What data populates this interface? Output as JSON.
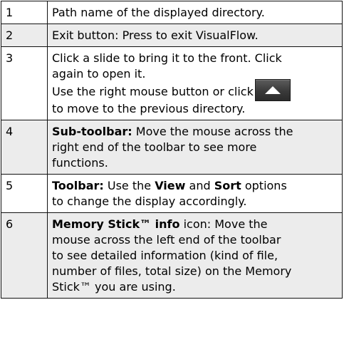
{
  "rows": [
    {
      "num": "1",
      "text": "Path name of the displayed directory."
    },
    {
      "num": "2",
      "text": "Exit button: Press to exit VisualFlow."
    },
    {
      "num": "3",
      "line1": "Click a slide to bring it to the front. Click",
      "line2": "again to open it.",
      "line3": "Use the right mouse button or click",
      "line4": "to move to the previous directory.",
      "icon": "up-arrow-button-icon"
    },
    {
      "num": "4",
      "bold": "Sub-toolbar:",
      "line1": " Move the mouse across the",
      "line2": "right end of the toolbar to see more",
      "line3": "functions."
    },
    {
      "num": "5",
      "bold1": "Toolbar:",
      "text1": " Use the ",
      "bold2": "View",
      "text2": " and ",
      "bold3": "Sort",
      "text3": " options",
      "line2": "to change the display accordingly."
    },
    {
      "num": "6",
      "bold": "Memory Stick™ info",
      "line1": " icon: Move the",
      "line2": "mouse across the left end of the toolbar",
      "line3": "to see detailed information (kind of file,",
      "line4": "number of files, total size) on the Memory",
      "line5": "Stick™ you are using."
    }
  ],
  "colors": {
    "border": "#111111",
    "shade": "#ececec",
    "icon_bg": "#3a3a3a",
    "icon_arrow": "#ffffff"
  }
}
